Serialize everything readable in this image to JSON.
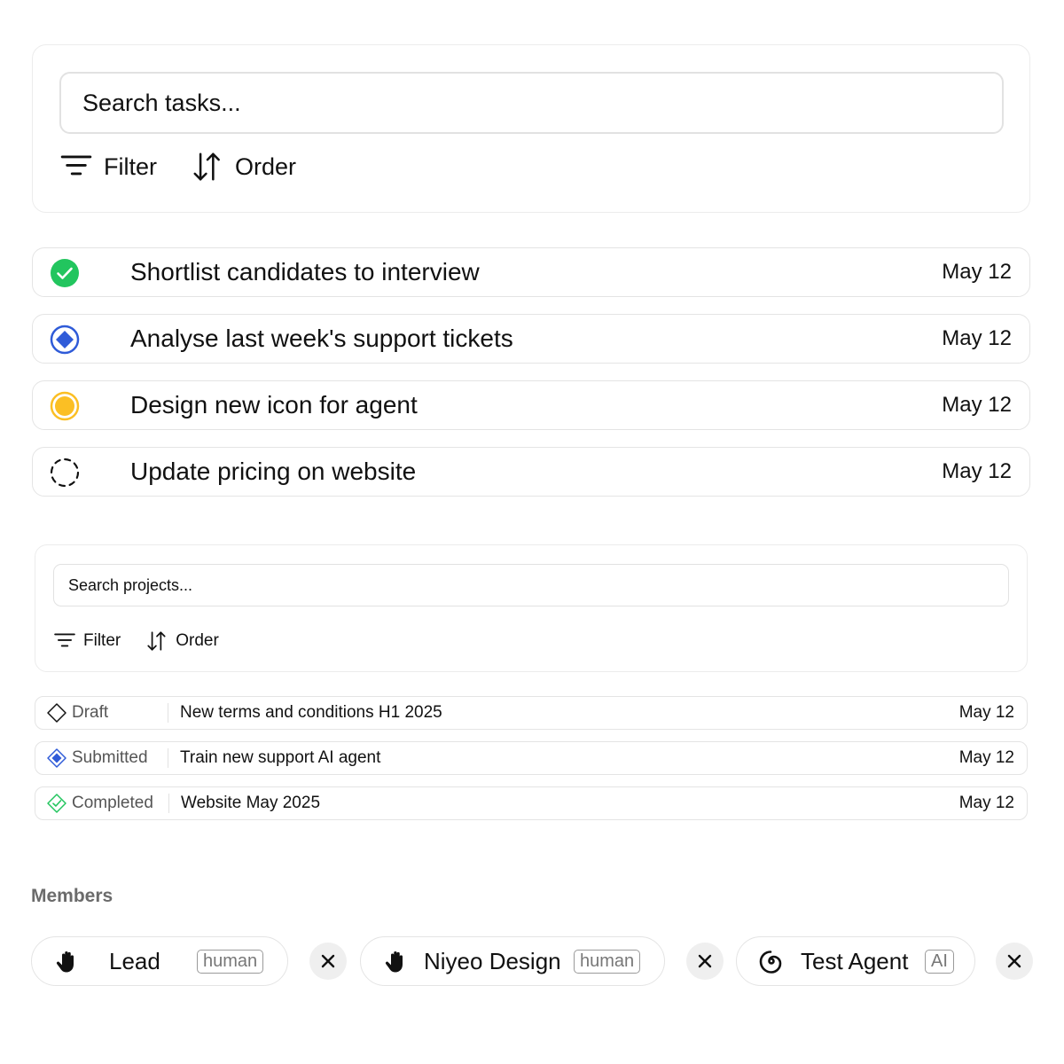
{
  "tasks_panel": {
    "search_placeholder": "Search tasks...",
    "filter_label": "Filter",
    "order_label": "Order"
  },
  "tasks": [
    {
      "title": "Shortlist candidates to interview",
      "date": "May 12",
      "status_icon": "check-circle-icon"
    },
    {
      "title": "Analyse last week's support tickets",
      "date": "May 12",
      "status_icon": "diamond-circle-icon"
    },
    {
      "title": "Design new icon for agent",
      "date": "May 12",
      "status_icon": "half-circle-icon"
    },
    {
      "title": "Update pricing on website",
      "date": "May 12",
      "status_icon": "dashed-circle-icon"
    }
  ],
  "projects_panel": {
    "search_placeholder": "Search projects...",
    "filter_label": "Filter",
    "order_label": "Order"
  },
  "projects": [
    {
      "status": "Draft",
      "name": "New terms and conditions H1 2025",
      "date": "May 12",
      "status_icon": "draft-diamond-icon"
    },
    {
      "status": "Submitted",
      "name": "Train new support AI agent",
      "date": "May 12",
      "status_icon": "submitted-diamond-icon"
    },
    {
      "status": "Completed",
      "name": "Website May 2025",
      "date": "May 12",
      "status_icon": "completed-diamond-icon"
    }
  ],
  "members": {
    "title": "Members",
    "items": [
      {
        "name": "Lead",
        "tag": "human",
        "icon": "hand-icon"
      },
      {
        "name": "Niyeo Design",
        "tag": "human",
        "icon": "hand-icon"
      },
      {
        "name": "Test Agent",
        "tag": "AI",
        "icon": "spiral-icon"
      }
    ]
  },
  "colors": {
    "complete_green": "#22c55e",
    "progress_blue": "#2f5bd8",
    "review_yellow": "#fbbf24",
    "border": "#e4e4e4"
  }
}
